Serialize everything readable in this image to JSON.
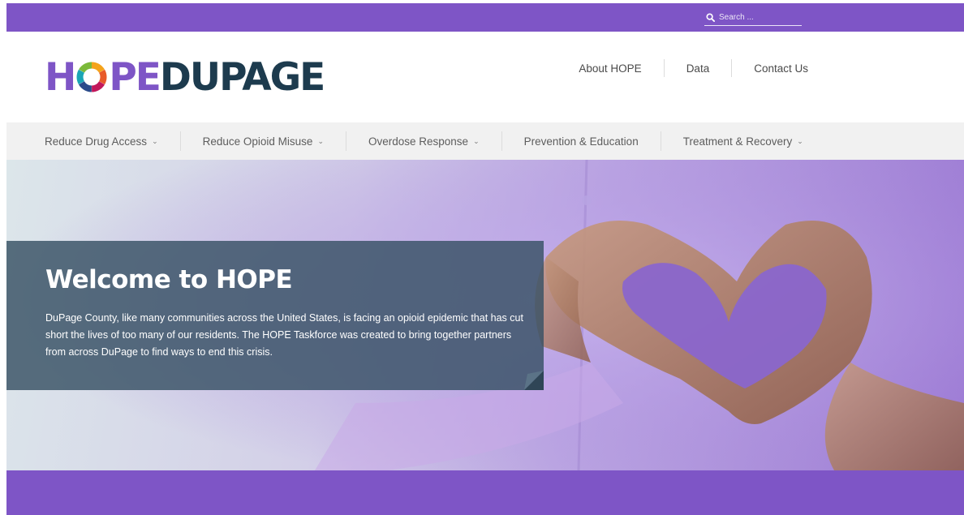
{
  "search": {
    "placeholder": "Search ..."
  },
  "logo": {
    "text_part1": "H",
    "text_part2": "PE",
    "text_part3": "DUPAGE"
  },
  "topnav": {
    "about": "About HOPE",
    "data": "Data",
    "contact": "Contact Us"
  },
  "mainnav": {
    "items": [
      {
        "label": "Reduce Drug Access",
        "has_dropdown": true
      },
      {
        "label": "Reduce Opioid Misuse",
        "has_dropdown": true
      },
      {
        "label": "Overdose Response",
        "has_dropdown": true
      },
      {
        "label": "Prevention & Education",
        "has_dropdown": false
      },
      {
        "label": "Treatment & Recovery",
        "has_dropdown": true
      }
    ],
    "chevron": "⌄"
  },
  "hero": {
    "title": "Welcome to HOPE",
    "body": "DuPage County, like many communities across the United States, is facing an opioid epidemic that has cut short the lives of too many of our residents. The HOPE Taskforce was created to bring together partners from across DuPage to find ways to end this crisis."
  },
  "colors": {
    "brand_purple": "#7e55c6",
    "brand_navy": "#1d3b4e",
    "overlay": "#37506 4"
  }
}
